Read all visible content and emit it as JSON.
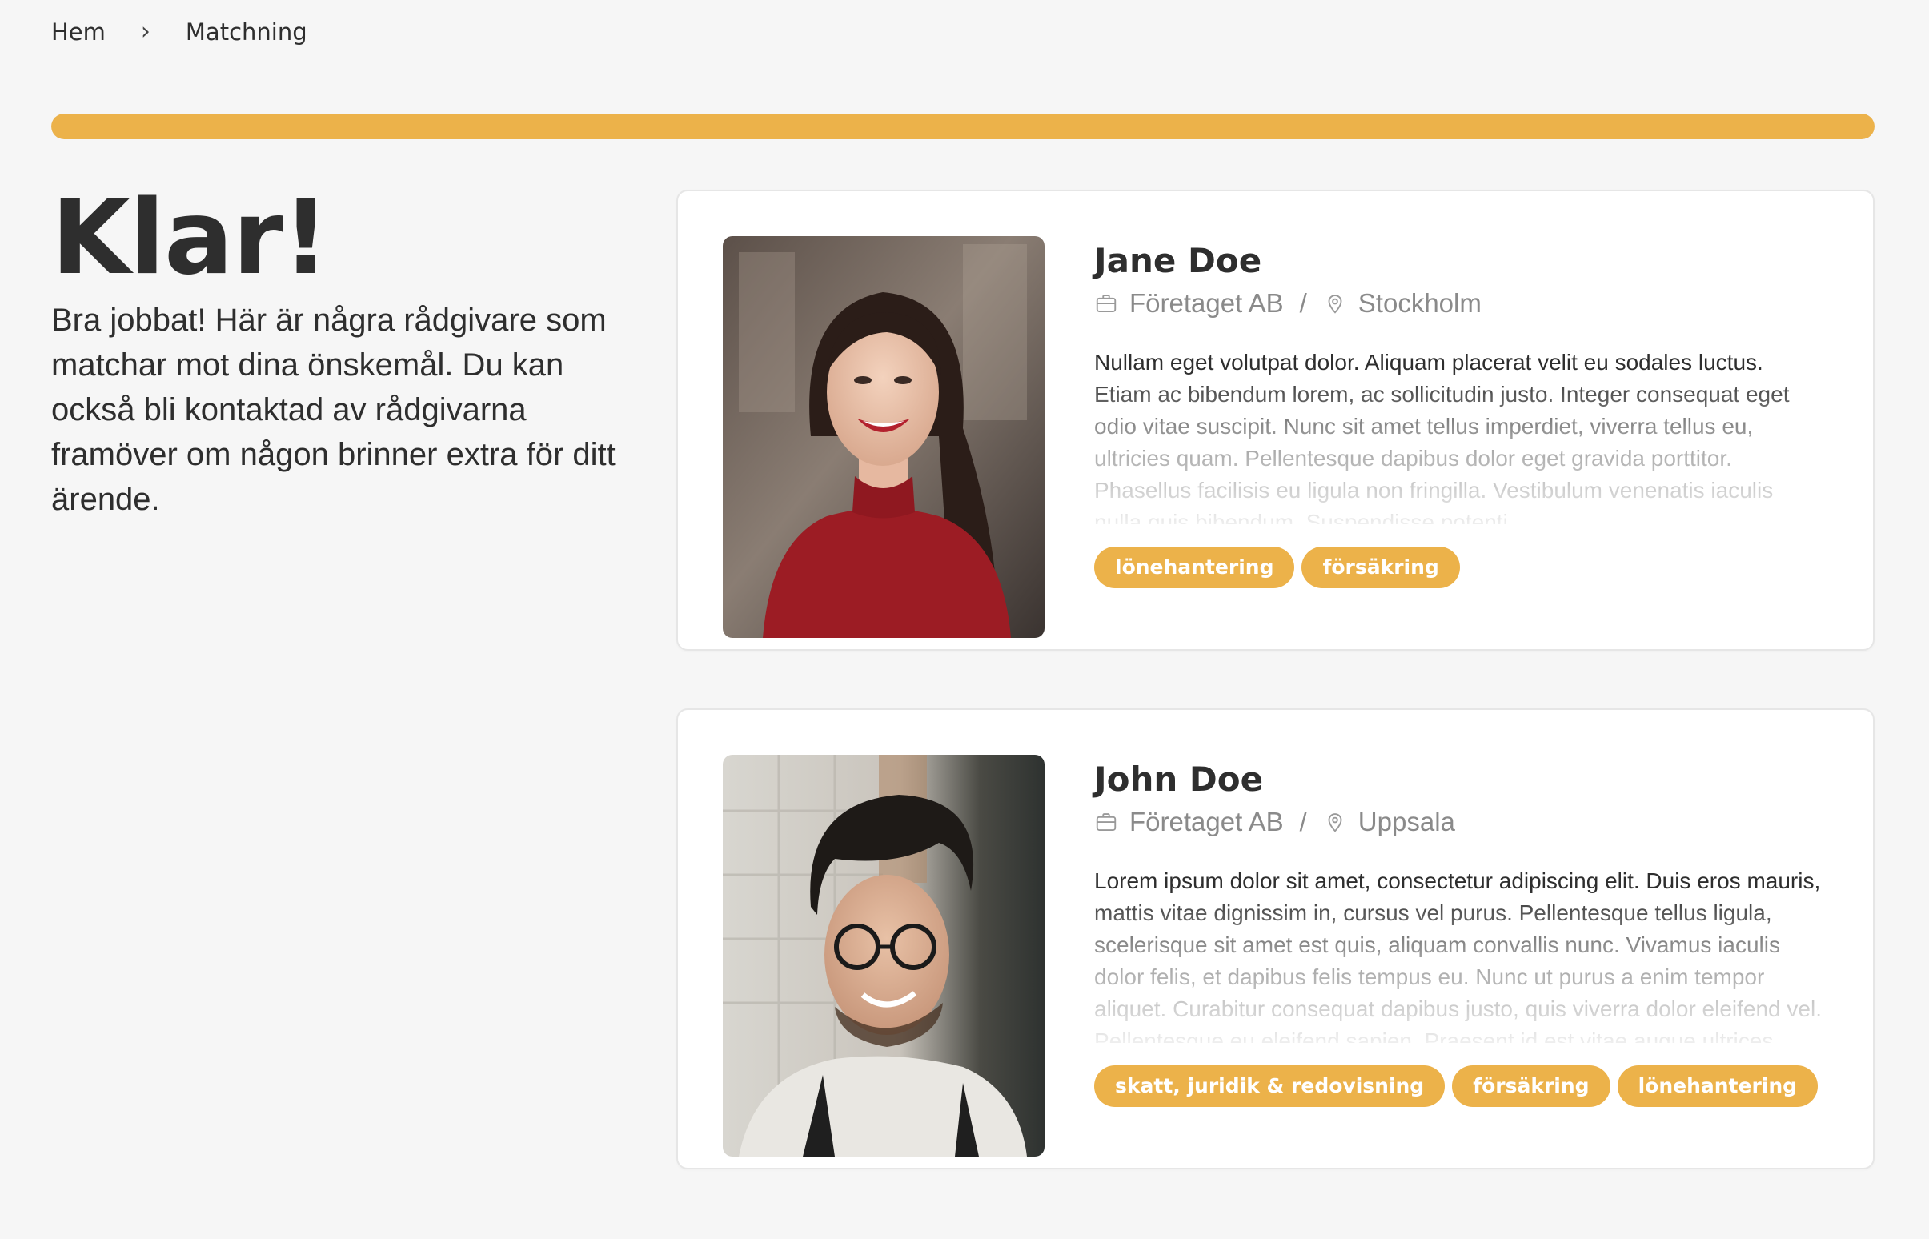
{
  "breadcrumb": {
    "home": "Hem",
    "current": "Matchning"
  },
  "progress": {
    "percent": 100,
    "color": "#ecb24a"
  },
  "intro": {
    "title": "Klar!",
    "text": "Bra jobbat! Här är några rådgivare som matchar mot dina önskemål. Du kan också bli kontaktad av rådgivarna framöver om någon brinner extra för ditt ärende."
  },
  "advisors": [
    {
      "name": "Jane Doe",
      "company": "Företaget AB",
      "separator": "/",
      "city": "Stockholm",
      "bio": "Nullam eget volutpat dolor. Aliquam placerat velit eu sodales luctus. Etiam ac bibendum lorem, ac sollicitudin justo. Integer consequat eget odio vitae suscipit. Nunc sit amet tellus imperdiet, viverra tellus eu, ultricies quam. Pellentesque dapibus dolor eget gravida porttitor. Phasellus facilisis eu ligula non fringilla. Vestibulum venenatis iaculis nulla quis bibendum. Suspendisse potenti.",
      "tags": [
        "lönehantering",
        "försäkring"
      ]
    },
    {
      "name": "John Doe",
      "company": "Företaget AB",
      "separator": "/",
      "city": "Uppsala",
      "bio": "Lorem ipsum dolor sit amet, consectetur adipiscing elit. Duis eros mauris, mattis vitae dignissim in, cursus vel purus. Pellentesque tellus ligula, scelerisque sit amet est quis, aliquam convallis nunc. Vivamus iaculis dolor felis, et dapibus felis tempus eu. Nunc ut purus a enim tempor aliquet. Curabitur consequat dapibus justo, quis viverra dolor eleifend vel. Pellentesque eu eleifend sapien. Praesent id est vitae augue ultrices.",
      "tags": [
        "skatt, juridik & redovisning",
        "försäkring",
        "lönehantering"
      ]
    }
  ],
  "icons": {
    "company": "briefcase-icon",
    "location": "map-pin-icon",
    "breadcrumb_separator": "chevron-right-icon"
  }
}
